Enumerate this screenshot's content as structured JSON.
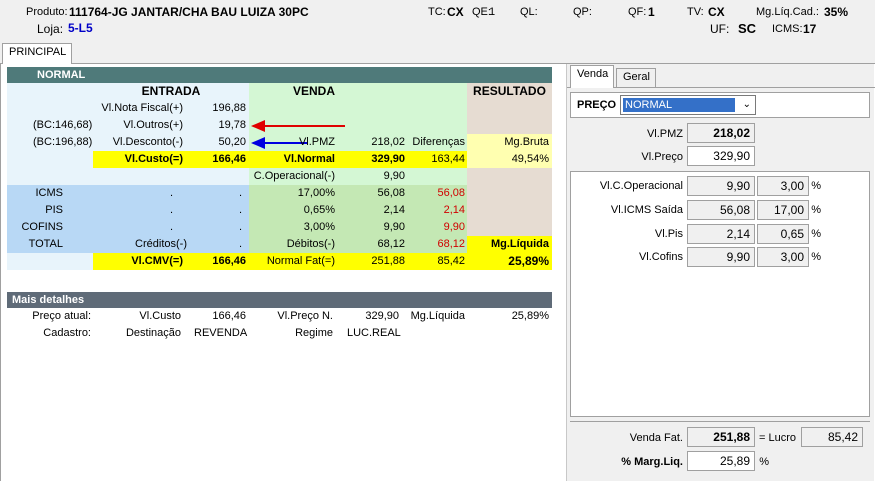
{
  "header": {
    "produto_label": "Produto:",
    "produto_value": "111764-JG JANTAR/CHA BAU LUIZA 30PC",
    "loja_label": "Loja:",
    "loja_value": "5-L5",
    "tc_label": "TC:",
    "tc_value": "CX",
    "qe_label": "QE:",
    "qe_value": "1",
    "ql_label": "QL:",
    "qp_label": "QP:",
    "qf_label": "QF:",
    "qf_value": "1",
    "tv_label": "TV:",
    "tv_value": "CX",
    "mg_label": "Mg.Líq.Cad.:",
    "mg_value": "35%",
    "uf_label": "UF:",
    "uf_value": "SC",
    "icms_label": "ICMS:",
    "icms_value": "17"
  },
  "main_tabs": [
    {
      "label": "PRINCIPAL"
    }
  ],
  "normal_bar": "NORMAL",
  "sections": {
    "entrada": "ENTRADA",
    "venda": "VENDA",
    "resultado": "RESULTADO"
  },
  "entrada": {
    "nota_label": "Vl.Nota Fiscal(+)",
    "nota_value": "196,88",
    "outros_bc": "(BC:146,68)",
    "outros_label": "Vl.Outros(+)",
    "outros_value": "19,78",
    "desc_bc": "(BC:196,88)",
    "desc_label": "Vl.Desconto(-)",
    "desc_value": "50,20",
    "custo_label": "Vl.Custo(=)",
    "custo_value": "166,46"
  },
  "venda": {
    "pmz_label": "Vl.PMZ",
    "pmz_value": "218,02",
    "dif_label": "Diferenças",
    "mgb_label": "Mg.Bruta",
    "normal_label": "Vl.Normal",
    "normal_value": "329,90",
    "dif_value": "163,44",
    "mgb_value": "49,54%",
    "cop_label": "C.Operacional(-)",
    "cop_value": "9,90"
  },
  "taxes": [
    {
      "name": "ICMS",
      "c1": ".",
      "c2": ".",
      "pct": "17,00%",
      "val": "56,08",
      "red": "56,08"
    },
    {
      "name": "PIS",
      "c1": ".",
      "c2": ".",
      "pct": "0,65%",
      "val": "2,14",
      "red": "2,14"
    },
    {
      "name": "COFINS",
      "c1": ".",
      "c2": ".",
      "pct": "3,00%",
      "val": "9,90",
      "red": "9,90"
    }
  ],
  "total": {
    "name": "TOTAL",
    "creditos": "Créditos(-)",
    "dot": ".",
    "debitos": "Débitos(-)",
    "deb_value": "68,12",
    "deb_red": "68,12",
    "mgliq": "Mg.Líquida"
  },
  "cmv": {
    "label": "Vl.CMV(=)",
    "value": "166,46",
    "fat_label": "Normal Fat(=)",
    "fat_value": "251,88",
    "fat_val2": "85,42",
    "pct": "25,89%"
  },
  "detalhes": {
    "title": "Mais detalhes",
    "row1": {
      "a": "Preço atual:",
      "b": "Vl.Custo",
      "c": "166,46",
      "d": "Vl.Preço N.",
      "e": "329,90",
      "f": "Mg.Líquida",
      "g": "25,89%"
    },
    "row2": {
      "a": "Cadastro:",
      "b": "Destinação",
      "c": "REVENDA",
      "d": "Regime",
      "e": "LUC.REAL"
    }
  },
  "right_tabs": [
    {
      "label": "Venda"
    },
    {
      "label": "Geral"
    }
  ],
  "preco": {
    "label": "PREÇO",
    "selected": "NORMAL"
  },
  "pmz": {
    "label": "Vl.PMZ",
    "value": "218,02"
  },
  "vpreco": {
    "label": "Vl.Preço",
    "value": "329,90"
  },
  "costs": [
    {
      "label": "Vl.C.Operacional",
      "value": "9,90",
      "pct": "3,00",
      "unit": "%"
    },
    {
      "label": "Vl.ICMS Saída",
      "value": "56,08",
      "pct": "17,00",
      "unit": "%"
    },
    {
      "label": "Vl.Pis",
      "value": "2,14",
      "pct": "0,65",
      "unit": "%"
    },
    {
      "label": "Vl.Cofins",
      "value": "9,90",
      "pct": "3,00",
      "unit": "%"
    }
  ],
  "venda_fat": {
    "label": "Venda Fat.",
    "value": "251,88",
    "lucro_label": "= Lucro",
    "lucro_value": "85,42"
  },
  "marg": {
    "label": "% Marg.Liq.",
    "value": "25,89",
    "unit": "%"
  },
  "colors": {
    "header_bar": "#4f7a7a",
    "entrada_bg": "#e8f4fb",
    "venda_bg": "#d4f7d4",
    "resultado_bg": "#e6dcd2",
    "yellow": "#ffff00",
    "tax_blue": "#b8d8f5",
    "tax_green": "#c4e8b4",
    "arrow_red": "#e00000",
    "arrow_blue": "#0000e0"
  }
}
